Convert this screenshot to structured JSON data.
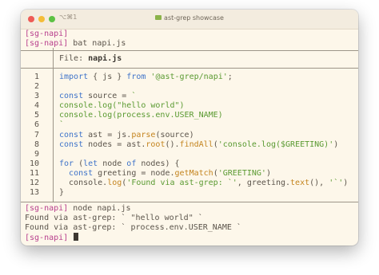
{
  "window": {
    "title": "ast-grep showcase",
    "shortcut": "⌥⌘1",
    "colors": {
      "background": "#fdf7ea",
      "prompt": "#b8408d",
      "keyword": "#3f73c9",
      "string": "#5a9a31",
      "function": "#c4841e",
      "text": "#5b544b"
    }
  },
  "terminal": {
    "lines_before": [
      {
        "prompt": "[sg-napi]",
        "command": ""
      },
      {
        "prompt": "[sg-napi]",
        "command": "bat napi.js"
      }
    ],
    "bat": {
      "file_label": "File: ",
      "file_name": "napi.js",
      "line_numbers": [
        "1",
        "2",
        "3",
        "4",
        "5",
        "6",
        "7",
        "8",
        "9",
        "10",
        "11",
        "12",
        "13"
      ]
    },
    "run": {
      "prompt": "[sg-napi]",
      "command": "node napi.js"
    },
    "output": [
      "Found via ast-grep: ` \"hello world\" `",
      "Found via ast-grep: ` process.env.USER_NAME `"
    ],
    "final_prompt": "[sg-napi]"
  }
}
